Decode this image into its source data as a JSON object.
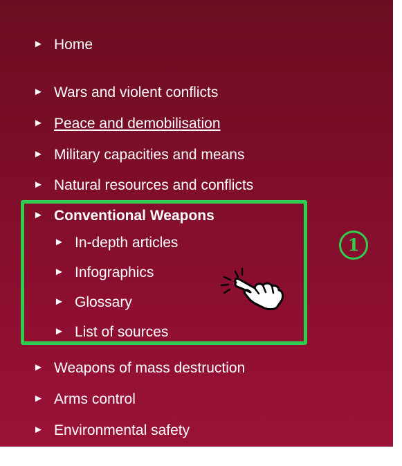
{
  "nav": {
    "arrow_glyph": "►",
    "items": [
      {
        "label": "Home"
      },
      {
        "label": "Wars and violent conflicts"
      },
      {
        "label": "Peace and demobilisation"
      },
      {
        "label": "Military capacities and means"
      },
      {
        "label": "Natural resources and conflicts"
      },
      {
        "label": "Conventional Weapons"
      },
      {
        "label": "In-depth articles"
      },
      {
        "label": "Infographics"
      },
      {
        "label": "Glossary"
      },
      {
        "label": "List of sources"
      },
      {
        "label": "Weapons of mass destruction"
      },
      {
        "label": "Arms control"
      },
      {
        "label": "Environmental safety"
      }
    ]
  },
  "annotation": {
    "step_number": "1",
    "box_color": "#2fce4e"
  },
  "colors": {
    "panel_top": "#6b0d22",
    "panel_bottom": "#9a1237",
    "text": "#ffffff"
  },
  "icons": {
    "pointer": "pointing-hand-cursor-icon"
  }
}
